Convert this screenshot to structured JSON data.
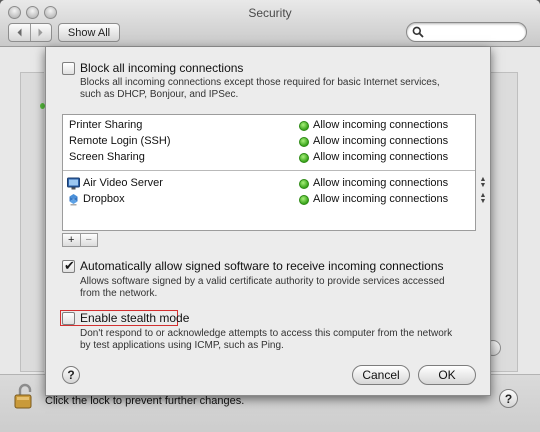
{
  "window": {
    "title": "Security"
  },
  "toolbar": {
    "back_icon": "chevron-left-icon",
    "forward_icon": "chevron-right-icon",
    "show_all_label": "Show All",
    "search_placeholder": ""
  },
  "sheet": {
    "block_all": {
      "checked": false,
      "label": "Block all incoming connections",
      "description_line1": "Blocks all incoming connections except those required for basic Internet services,",
      "description_line2": "such as DHCP, Bonjour, and IPSec."
    },
    "services": [
      {
        "name": "Printer Sharing",
        "status": "Allow incoming connections"
      },
      {
        "name": "Remote Login (SSH)",
        "status": "Allow incoming connections"
      },
      {
        "name": "Screen Sharing",
        "status": "Allow incoming connections"
      }
    ],
    "apps": [
      {
        "name": "Air Video Server",
        "status": "Allow incoming connections",
        "icon": "monitor-app-icon"
      },
      {
        "name": "Dropbox",
        "status": "Allow incoming connections",
        "icon": "dropbox-icon"
      }
    ],
    "add_label": "+",
    "remove_label": "−",
    "signed_software": {
      "checked": true,
      "label": "Automatically allow signed software to receive incoming connections",
      "description_line1": "Allows software signed by a valid certificate authority to provide services accessed",
      "description_line2": "from the network."
    },
    "stealth": {
      "checked": false,
      "label": "Enable stealth mode",
      "description_line1": "Don't respond to or acknowledge attempts to access this computer from the network",
      "description_line2": "by test applications using ICMP, such as Ping."
    },
    "help_label": "?",
    "cancel_label": "Cancel",
    "ok_label": "OK",
    "status_color": "#3aa41c"
  },
  "bottom": {
    "lock_text": "Click the lock to prevent further changes.",
    "help_label": "?"
  }
}
